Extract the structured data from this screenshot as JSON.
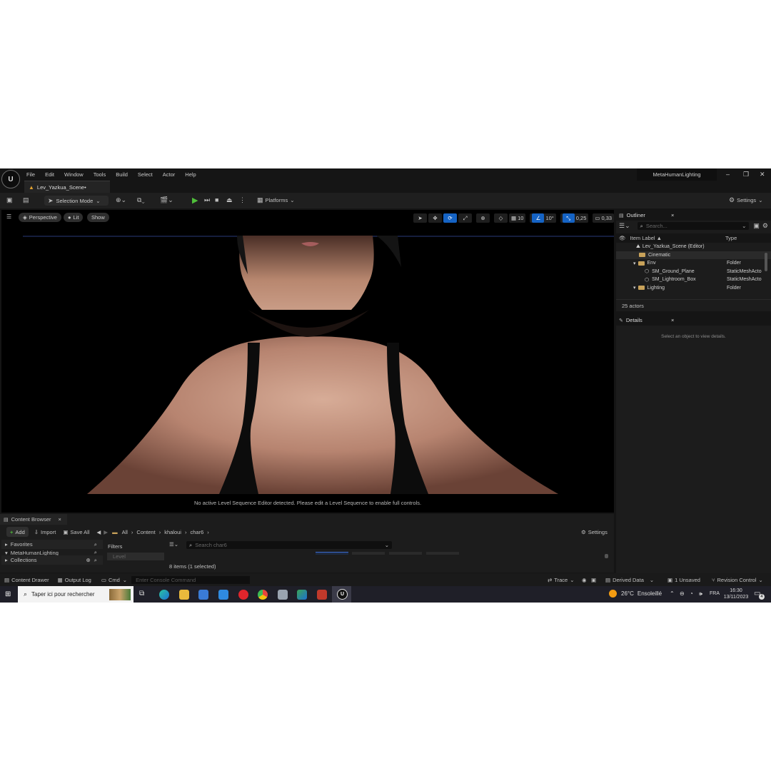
{
  "app": {
    "logo": "U",
    "project_name": "MetaHumanLighting",
    "menu": [
      "File",
      "Edit",
      "Window",
      "Tools",
      "Build",
      "Select",
      "Actor",
      "Help"
    ],
    "level_tab": "Lev_Yazkua_Scene•",
    "window_controls": {
      "minimize": "–",
      "restore": "❐",
      "close": "✕"
    }
  },
  "toolbar": {
    "selection_mode": "Selection Mode",
    "platforms": "Platforms",
    "settings": "Settings"
  },
  "viewport": {
    "perspective": "Perspective",
    "lit": "Lit",
    "show": "Show",
    "grid_snap": "10",
    "rotation_snap": "10°",
    "scale_snap": "0,25",
    "camera_speed": "0,33",
    "notice": "No active Level Sequence Editor detected. Please edit a Level Sequence to enable full controls."
  },
  "outliner": {
    "title": "Outliner",
    "search_placeholder": "Search...",
    "col_label": "Item Label ▲",
    "col_type": "Type",
    "rows": [
      {
        "label": "Lev_Yazkua_Scene (Editor)",
        "type": ""
      },
      {
        "label": "Cinematic",
        "type": ""
      },
      {
        "label": "Env",
        "type": "Folder"
      },
      {
        "label": "SM_Ground_Plane",
        "type": "StaticMeshActo"
      },
      {
        "label": "SM_Lightroom_Box",
        "type": "StaticMeshActo"
      },
      {
        "label": "Lighting",
        "type": "Folder"
      }
    ],
    "actor_count": "25 actors"
  },
  "details": {
    "title": "Details",
    "empty_message": "Select an object to view details."
  },
  "content_browser": {
    "title": "Content Browser",
    "add": "Add",
    "import": "Import",
    "save_all": "Save All",
    "breadcrumb": [
      "All",
      "Content",
      "khaloui",
      "char6"
    ],
    "settings": "Settings",
    "favorites": "Favorites",
    "meta_folder": "MetaHumanLighting",
    "collections": "Collections",
    "filters": "Filters",
    "filter_item": "Level",
    "search_placeholder": "Search char6",
    "item_count": "8 items (1 selected)"
  },
  "statusbar": {
    "content_drawer": "Content Drawer",
    "output_log": "Output Log",
    "cmd": "Cmd",
    "console_placeholder": "Enter Console Command",
    "trace": "Trace",
    "derived_data": "Derived Data",
    "unsaved": "1 Unsaved",
    "revision_control": "Revision Control"
  },
  "taskbar": {
    "search_placeholder": "Taper ici pour rechercher",
    "weather_temp": "26°C",
    "weather_desc": "Ensoleillé",
    "language": "FRA",
    "time": "16:30",
    "date": "13/11/2023",
    "notification_count": "4"
  }
}
